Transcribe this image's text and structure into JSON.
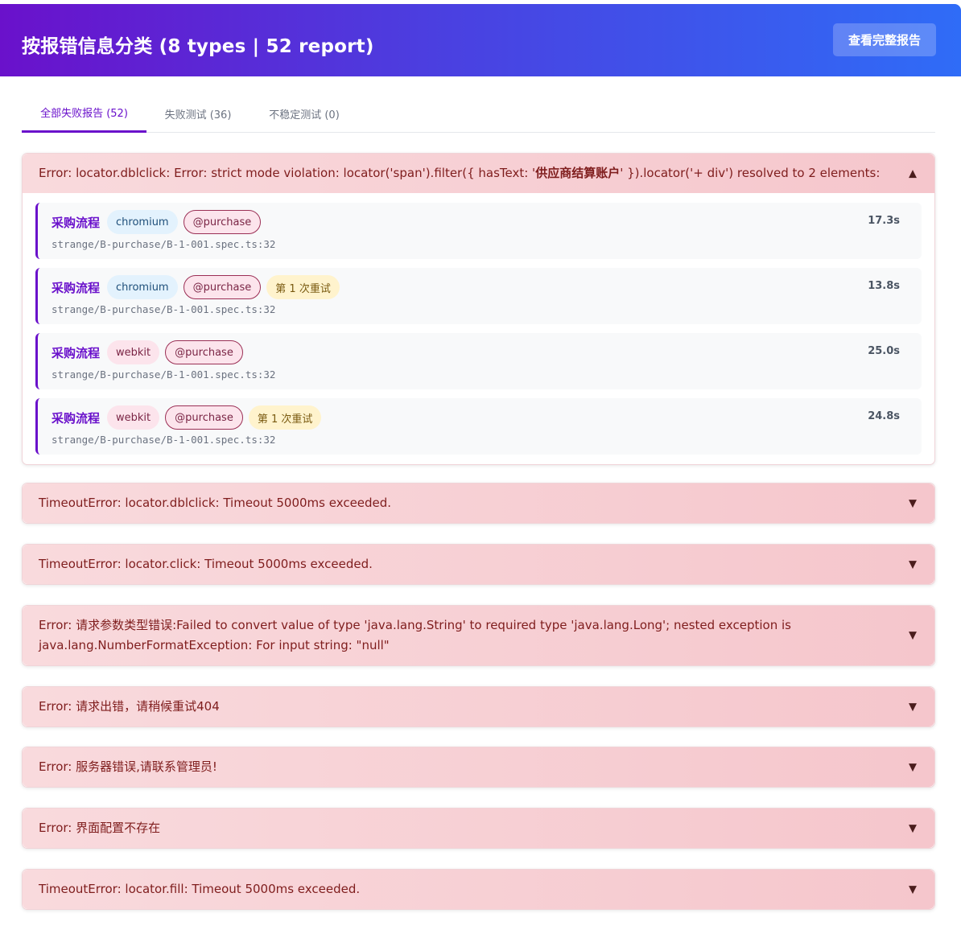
{
  "header": {
    "title": "按报错信息分类 (8 types | 52 report)",
    "report_button": "查看完整报告"
  },
  "tabs": [
    {
      "label": "全部失败报告 (52)",
      "active": true
    },
    {
      "label": "失败测试 (36)",
      "active": false
    },
    {
      "label": "不稳定测试 (0)",
      "active": false
    }
  ],
  "colors": {
    "accent": "#6a11cb",
    "header_gradient_start": "#6a11cb",
    "header_gradient_end": "#2f6cf7",
    "error_bg": "#f5c6cc",
    "error_text": "#7f1d1d"
  },
  "groups": [
    {
      "title_prefix": "Error: locator.dblclick: Error: strict mode violation: locator('span').filter({ hasText: '",
      "title_bold": "供应商结算账户",
      "title_suffix": "' }).locator('+ div') resolved to 2 elements:",
      "chevron": "▲",
      "expanded": true,
      "items": [
        {
          "name": "采购流程",
          "browser": "chromium",
          "tag": "@purchase",
          "retry": "",
          "path": "strange/B-purchase/B-1-001.spec.ts:32",
          "duration": "17.3s"
        },
        {
          "name": "采购流程",
          "browser": "chromium",
          "tag": "@purchase",
          "retry": "第 1 次重试",
          "path": "strange/B-purchase/B-1-001.spec.ts:32",
          "duration": "13.8s"
        },
        {
          "name": "采购流程",
          "browser": "webkit",
          "tag": "@purchase",
          "retry": "",
          "path": "strange/B-purchase/B-1-001.spec.ts:32",
          "duration": "25.0s"
        },
        {
          "name": "采购流程",
          "browser": "webkit",
          "tag": "@purchase",
          "retry": "第 1 次重试",
          "path": "strange/B-purchase/B-1-001.spec.ts:32",
          "duration": "24.8s"
        }
      ]
    },
    {
      "title": "TimeoutError: locator.dblclick: Timeout 5000ms exceeded.",
      "chevron": "▼",
      "expanded": false
    },
    {
      "title": "TimeoutError: locator.click: Timeout 5000ms exceeded.",
      "chevron": "▼",
      "expanded": false
    },
    {
      "title": "Error: 请求参数类型错误:Failed to convert value of type 'java.lang.String' to required type 'java.lang.Long'; nested exception is java.lang.NumberFormatException: For input string: \"null\"",
      "chevron": "▼",
      "expanded": false
    },
    {
      "title": "Error: 请求出错，请稍候重试404",
      "chevron": "▼",
      "expanded": false
    },
    {
      "title": "Error: 服务器错误,请联系管理员!",
      "chevron": "▼",
      "expanded": false
    },
    {
      "title": "Error: 界面配置不存在",
      "chevron": "▼",
      "expanded": false
    },
    {
      "title": "TimeoutError: locator.fill: Timeout 5000ms exceeded.",
      "chevron": "▼",
      "expanded": false
    }
  ]
}
